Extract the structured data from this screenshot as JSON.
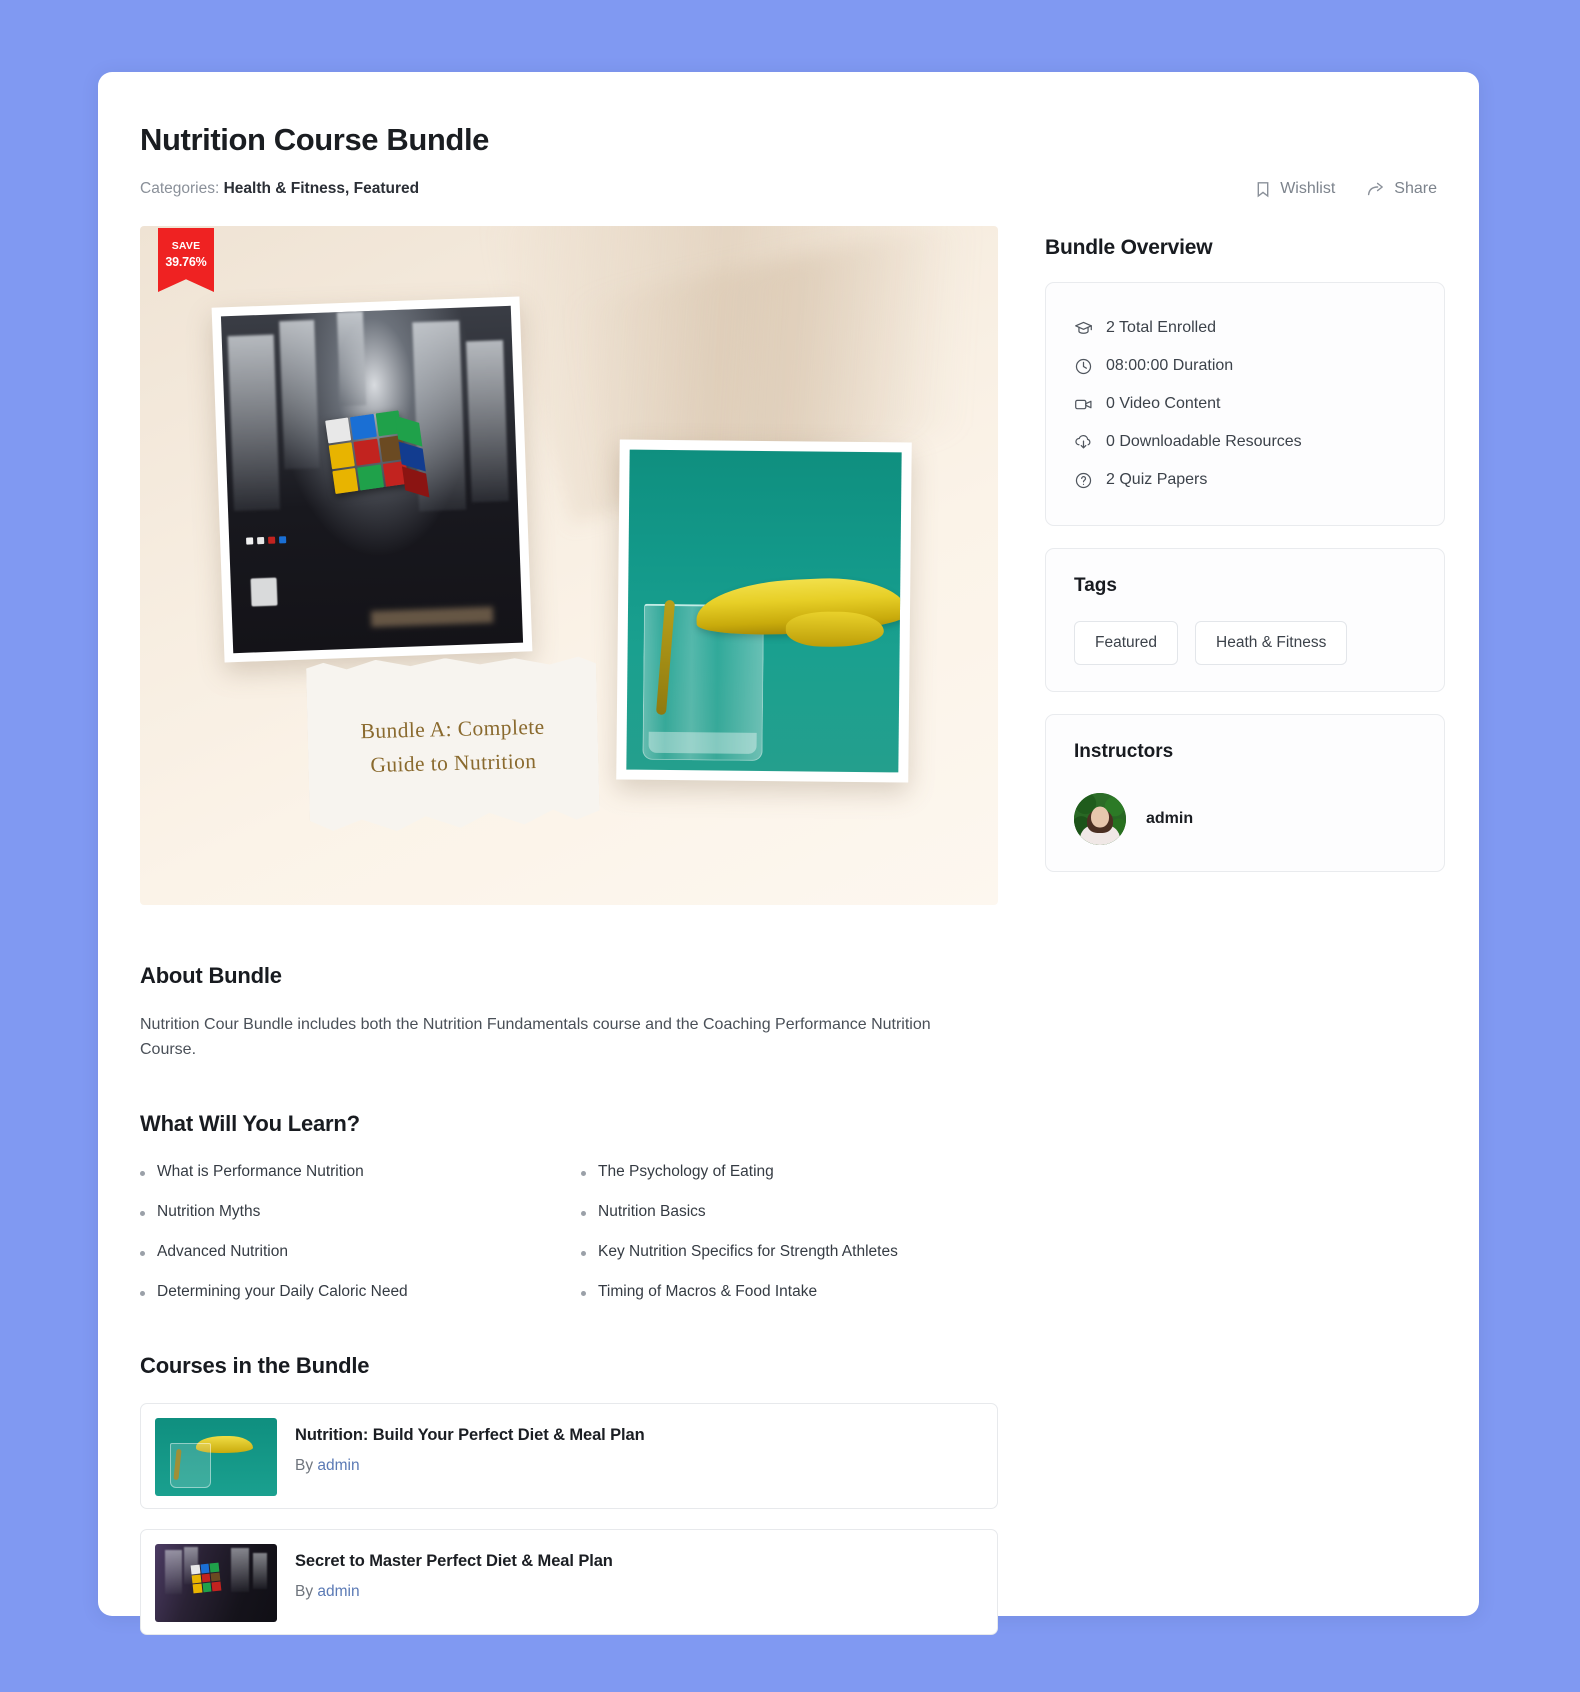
{
  "theme": {
    "page_background": "#8099f2",
    "card_background": "#ffffff",
    "accent_link": "#5b7ab5",
    "badge_red": "#ef2222",
    "text_primary": "#1a1d21",
    "text_muted": "#8a9099"
  },
  "header": {
    "title": "Nutrition Course Bundle",
    "categories_label": "Categories:",
    "categories": "Health & Fitness, Featured",
    "actions": [
      {
        "label": "Wishlist",
        "icon": "bookmark-icon"
      },
      {
        "label": "Share",
        "icon": "share-icon"
      }
    ]
  },
  "hero": {
    "save_label": "SAVE",
    "save_percent": "39.76%",
    "caption_line1": "Bundle A: Complete",
    "caption_line2": "Guide to Nutrition"
  },
  "about": {
    "heading": "About Bundle",
    "text": "Nutrition Cour Bundle includes both the Nutrition Fundamentals course and the Coaching Performance Nutrition Course."
  },
  "learn": {
    "heading": "What Will You Learn?",
    "items": [
      "What is Performance Nutrition",
      "The Psychology of Eating",
      "Nutrition Myths",
      "Nutrition Basics",
      "Advanced Nutrition",
      "Key Nutrition Specifics for Strength Athletes",
      "Determining your Daily Caloric Need",
      "Timing of Macros & Food Intake"
    ]
  },
  "courses": {
    "heading": "Courses in the Bundle",
    "by_label": "By",
    "items": [
      {
        "title": "Nutrition: Build Your Perfect Diet & Meal Plan",
        "author": "admin",
        "thumb": "green-oil-glass"
      },
      {
        "title": "Secret to Master Perfect Diet & Meal Plan",
        "author": "admin",
        "thumb": "dark-rubiks-cube"
      }
    ]
  },
  "sidebar": {
    "overview_title": "Bundle Overview",
    "overview_items": [
      {
        "icon": "graduation-cap-icon",
        "label": "2 Total Enrolled"
      },
      {
        "icon": "clock-icon",
        "label": "08:00:00 Duration"
      },
      {
        "icon": "video-camera-icon",
        "label": "0 Video Content"
      },
      {
        "icon": "cloud-download-icon",
        "label": "0 Downloadable Resources"
      },
      {
        "icon": "question-circle-icon",
        "label": "2 Quiz Papers"
      }
    ],
    "tags_title": "Tags",
    "tags": [
      "Featured",
      "Heath & Fitness"
    ],
    "instructors_title": "Instructors",
    "instructors": [
      {
        "name": "admin"
      }
    ]
  }
}
